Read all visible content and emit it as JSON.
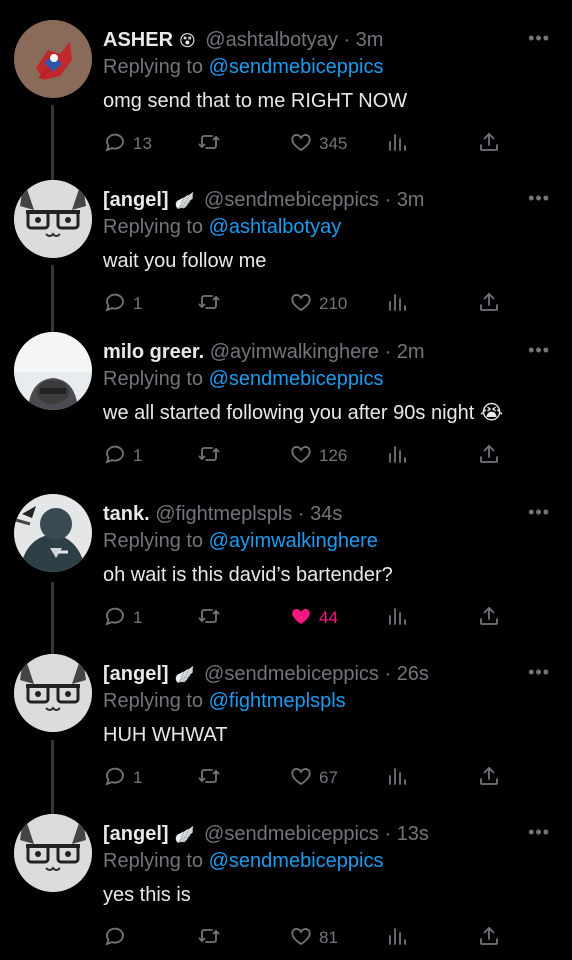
{
  "tweets": [
    {
      "name": "ASHER",
      "badge": "😵",
      "handle": "@ashtalbotyay",
      "time": "3m",
      "replying_prefix": "Replying to",
      "replying_to": "@sendmebiceppics",
      "text": "omg send that to me RIGHT NOW",
      "replies": "13",
      "retweets": "",
      "likes": "345",
      "liked": false,
      "avatar": "spiderman"
    },
    {
      "name": "[angel]",
      "badge": "🪽",
      "handle": "@sendmebiceppics",
      "time": "3m",
      "replying_prefix": "Replying to",
      "replying_to": "@ashtalbotyay",
      "text": "wait you follow me",
      "replies": "1",
      "retweets": "",
      "likes": "210",
      "liked": false,
      "avatar": "cat"
    },
    {
      "name": "milo greer.",
      "badge": "",
      "handle": "@ayimwalkinghere",
      "time": "2m",
      "replying_prefix": "Replying to",
      "replying_to": "@sendmebiceppics",
      "text": "we all started following you after 90s night 😭",
      "replies": "1",
      "retweets": "",
      "likes": "126",
      "liked": false,
      "avatar": "person"
    },
    {
      "name": "tank.",
      "badge": "",
      "handle": "@fightmeplspls",
      "time": "34s",
      "replying_prefix": "Replying to",
      "replying_to": "@ayimwalkinghere",
      "text": "oh wait is this david’s bartender?",
      "replies": "1",
      "retweets": "",
      "likes": "44",
      "liked": true,
      "avatar": "punisher"
    },
    {
      "name": "[angel]",
      "badge": "🪽",
      "handle": "@sendmebiceppics",
      "time": "26s",
      "replying_prefix": "Replying to",
      "replying_to": "@fightmeplspls",
      "text": "HUH WHWAT",
      "replies": "1",
      "retweets": "",
      "likes": "67",
      "liked": false,
      "avatar": "cat"
    },
    {
      "name": "[angel]",
      "badge": "🪽",
      "handle": "@sendmebiceppics",
      "time": "13s",
      "replying_prefix": "Replying to",
      "replying_to": "@sendmebiceppics",
      "text": "yes this is",
      "replies": "",
      "retweets": "",
      "likes": "81",
      "liked": false,
      "avatar": "cat"
    }
  ],
  "more_label": "•••",
  "colors": {
    "link": "#1d9bf0",
    "muted": "#71767b",
    "like": "#f91880",
    "background": "#000000"
  }
}
